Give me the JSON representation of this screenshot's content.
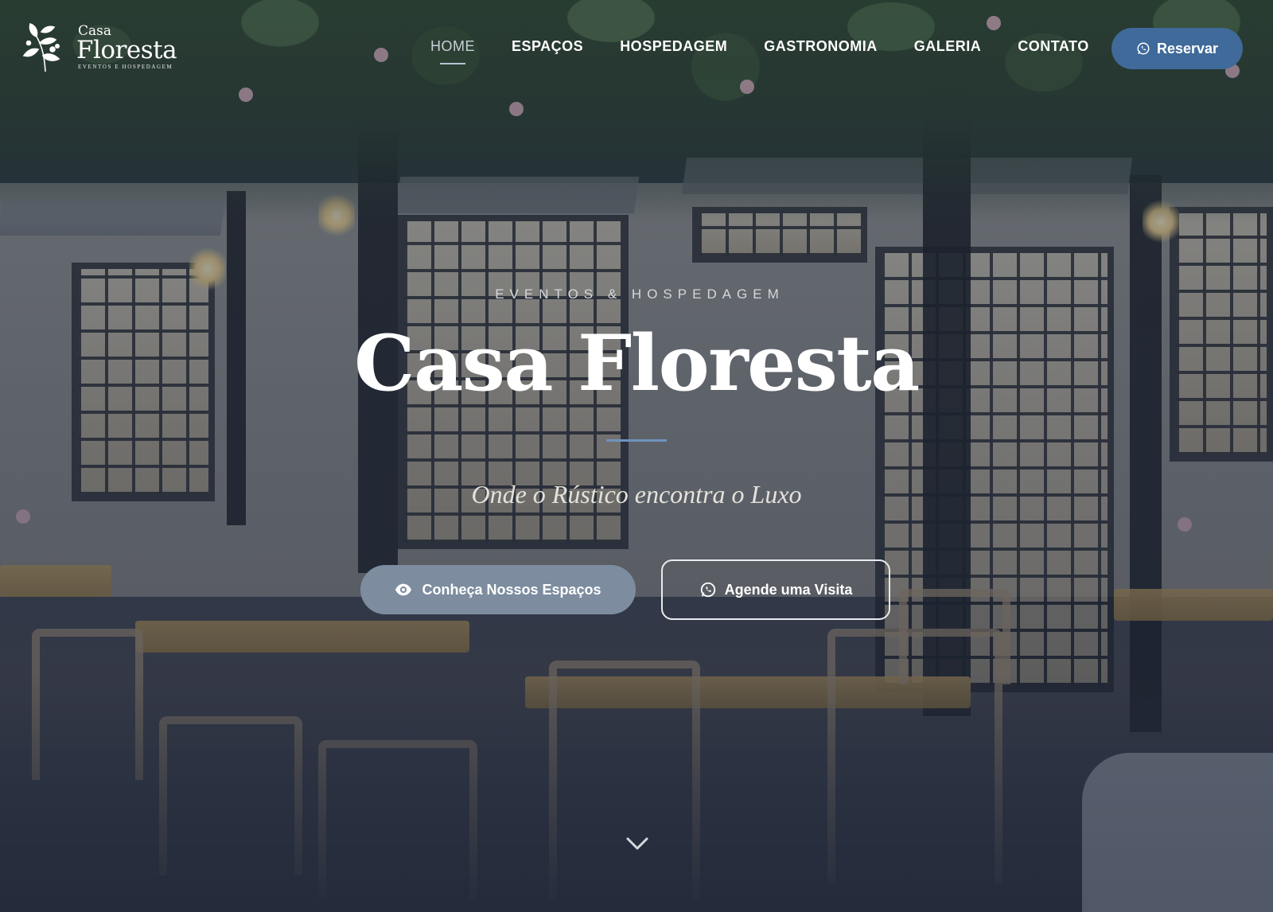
{
  "brand": {
    "small": "Casa",
    "name": "Floresta",
    "tagline": "EVENTOS E HOSPEDAGEM"
  },
  "nav": {
    "items": [
      {
        "label": "HOME",
        "active": true
      },
      {
        "label": "ESPAÇOS"
      },
      {
        "label": "HOSPEDAGEM"
      },
      {
        "label": "GASTRONOMIA"
      },
      {
        "label": "GALERIA"
      },
      {
        "label": "CONTATO"
      }
    ],
    "reserve_label": "Reservar",
    "reserve_icon": "whatsapp-icon"
  },
  "hero": {
    "eyebrow": "EVENTOS & HOSPEDAGEM",
    "title": "Casa Floresta",
    "subtitle": "Onde o Rústico encontra o Luxo",
    "primary_cta": "Conheça Nossos Espaços",
    "primary_icon": "eye-icon",
    "secondary_cta": "Agende uma Visita",
    "secondary_icon": "whatsapp-icon",
    "scroll_icon": "chevron-down-icon"
  },
  "colors": {
    "accent": "#3f6a9a",
    "primary_button": "#7d8c9f",
    "divider": "#6f93bd"
  }
}
